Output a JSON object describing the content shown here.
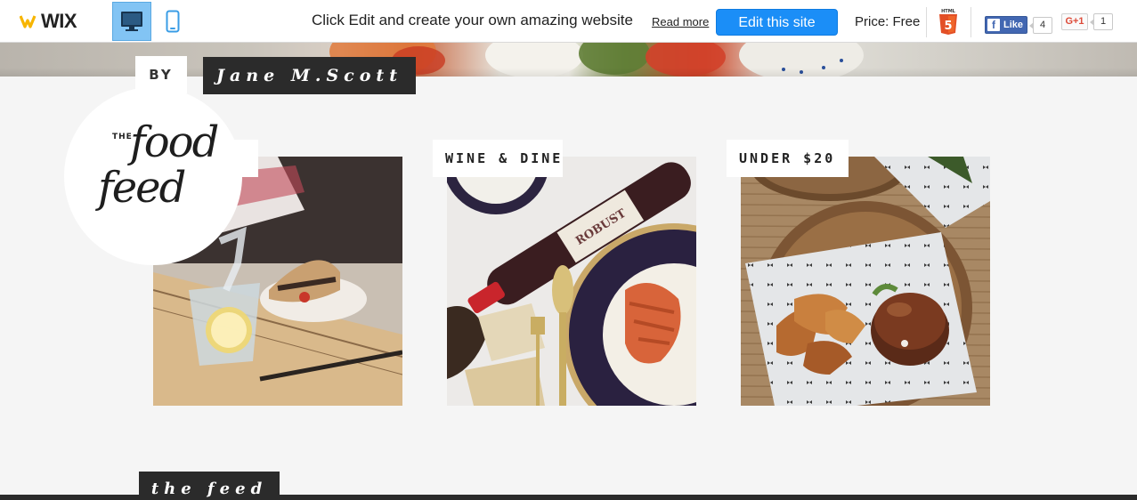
{
  "topbar": {
    "brand": "WIX",
    "device_desktop": "desktop-icon",
    "device_mobile": "mobile-icon",
    "promo_text": "Click Edit and create your own amazing website",
    "read_more": "Read more",
    "edit_button": "Edit this site",
    "price": "Price: Free",
    "facebook_like": "Like",
    "facebook_count": "4",
    "gplus_label": "G+1",
    "gplus_count": "1",
    "colors": {
      "edit_button": "#1b8ef7",
      "active_device": "#82c4f4",
      "facebook": "#4267b2",
      "html5": "#e34f26"
    }
  },
  "site": {
    "by_label": "BY",
    "author": "Jane M.Scott",
    "logo": {
      "the": "THE",
      "food": "food",
      "feed": "feed"
    },
    "categories": [
      {
        "label": "",
        "image": "water-and-sandwich-photo"
      },
      {
        "label": "WINE & DINE",
        "image": "wine-and-pasta-photo"
      },
      {
        "label": "UNDER $20",
        "image": "burger-and-fries-photo"
      }
    ],
    "feed_label": "the feed"
  }
}
